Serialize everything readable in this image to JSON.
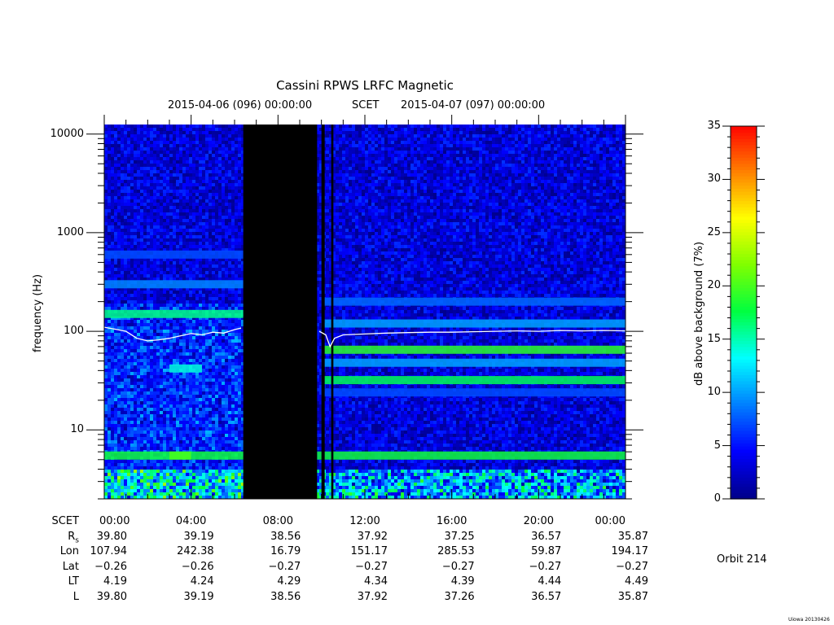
{
  "chart_data": {
    "type": "heatmap",
    "title": "Cassini RPWS LRFC Magnetic",
    "subtitle": {
      "start": "2015-04-06 (096) 00:00:00",
      "scet": "SCET",
      "end": "2015-04-07 (097) 00:00:00"
    },
    "ylabel": "frequency (Hz)",
    "yscale": "log",
    "ylim": [
      2,
      12500
    ],
    "y_ticks": [
      10,
      100,
      1000,
      10000
    ],
    "y_tick_labels": [
      "10",
      "100",
      "1000",
      "10000"
    ],
    "x_ticks_hours": [
      0,
      4,
      8,
      12,
      16,
      20,
      24
    ],
    "xlim_hours": [
      0,
      24
    ],
    "colorbar": {
      "label": "dB above background (7%)",
      "range": [
        0,
        35
      ],
      "ticks": [
        0,
        5,
        10,
        15,
        20,
        25,
        30,
        35
      ],
      "tick_labels": [
        "0",
        "5",
        "10",
        "15",
        "20",
        "25",
        "30",
        "35"
      ],
      "colors": [
        "#00008b",
        "#0000ff",
        "#0080ff",
        "#00ffff",
        "#00ff40",
        "#80ff00",
        "#ffff00",
        "#ff8000",
        "#ff0000"
      ]
    },
    "data_gaps_hours": [
      [
        6.4,
        9.8
      ],
      [
        10.0,
        10.15
      ],
      [
        10.45,
        10.55
      ]
    ],
    "bands_hz": [
      {
        "freq": 5.5,
        "from": 0,
        "to": 24,
        "level": 18
      },
      {
        "freq": 5.5,
        "from": 3,
        "to": 4,
        "level": 20
      },
      {
        "freq": 32,
        "from": 10,
        "to": 24,
        "level": 17
      },
      {
        "freq": 65,
        "from": 10,
        "to": 24,
        "level": 19
      },
      {
        "freq": 48,
        "from": 10,
        "to": 24,
        "level": 10
      },
      {
        "freq": 24,
        "from": 10,
        "to": 24,
        "level": 7
      },
      {
        "freq": 120,
        "from": 10,
        "to": 24,
        "level": 10
      },
      {
        "freq": 200,
        "from": 10,
        "to": 24,
        "level": 8
      },
      {
        "freq": 150,
        "from": 0,
        "to": 6.4,
        "level": 16
      },
      {
        "freq": 300,
        "from": 0,
        "to": 6.4,
        "level": 9
      },
      {
        "freq": 600,
        "from": 0,
        "to": 6.4,
        "level": 7
      },
      {
        "freq": 42,
        "from": 3,
        "to": 4.5,
        "level": 14
      }
    ],
    "series": [
      {
        "hours": [
          0,
          0.5,
          1,
          1.5,
          2,
          2.5,
          3,
          3.5,
          4,
          4.5,
          5,
          5.5,
          6,
          6.3
        ],
        "freq_hz": [
          110,
          105,
          100,
          85,
          80,
          82,
          85,
          90,
          95,
          92,
          98,
          96,
          104,
          108
        ]
      },
      {
        "hours": [
          9.9,
          10.2,
          10.4,
          10.6,
          11,
          12,
          13,
          14,
          15,
          16,
          17,
          18,
          19,
          20,
          21,
          22,
          23,
          24
        ],
        "freq_hz": [
          100,
          92,
          70,
          85,
          92,
          94,
          96,
          97,
          98,
          98,
          99,
          100,
          101,
          100,
          102,
          101,
          102,
          101
        ]
      }
    ]
  },
  "ephemeris": {
    "rows": [
      {
        "label": "SCET",
        "values": [
          "00:00",
          "04:00",
          "08:00",
          "12:00",
          "16:00",
          "20:00",
          "00:00"
        ]
      },
      {
        "label": "R",
        "sub": "s",
        "values": [
          "39.80",
          "39.19",
          "38.56",
          "37.92",
          "37.25",
          "36.57",
          "35.87"
        ]
      },
      {
        "label": "Lon",
        "values": [
          "107.94",
          "242.38",
          "16.79",
          "151.17",
          "285.53",
          "59.87",
          "194.17"
        ]
      },
      {
        "label": "Lat",
        "values": [
          "−0.26",
          "−0.26",
          "−0.27",
          "−0.27",
          "−0.27",
          "−0.27",
          "−0.27"
        ]
      },
      {
        "label": "LT",
        "values": [
          "4.19",
          "4.24",
          "4.29",
          "4.34",
          "4.39",
          "4.44",
          "4.49"
        ]
      },
      {
        "label": "L",
        "values": [
          "39.80",
          "39.19",
          "38.56",
          "37.92",
          "37.26",
          "36.57",
          "35.87"
        ]
      }
    ]
  },
  "orbit": "Orbit 214",
  "footer": "Uiowa 20130426"
}
